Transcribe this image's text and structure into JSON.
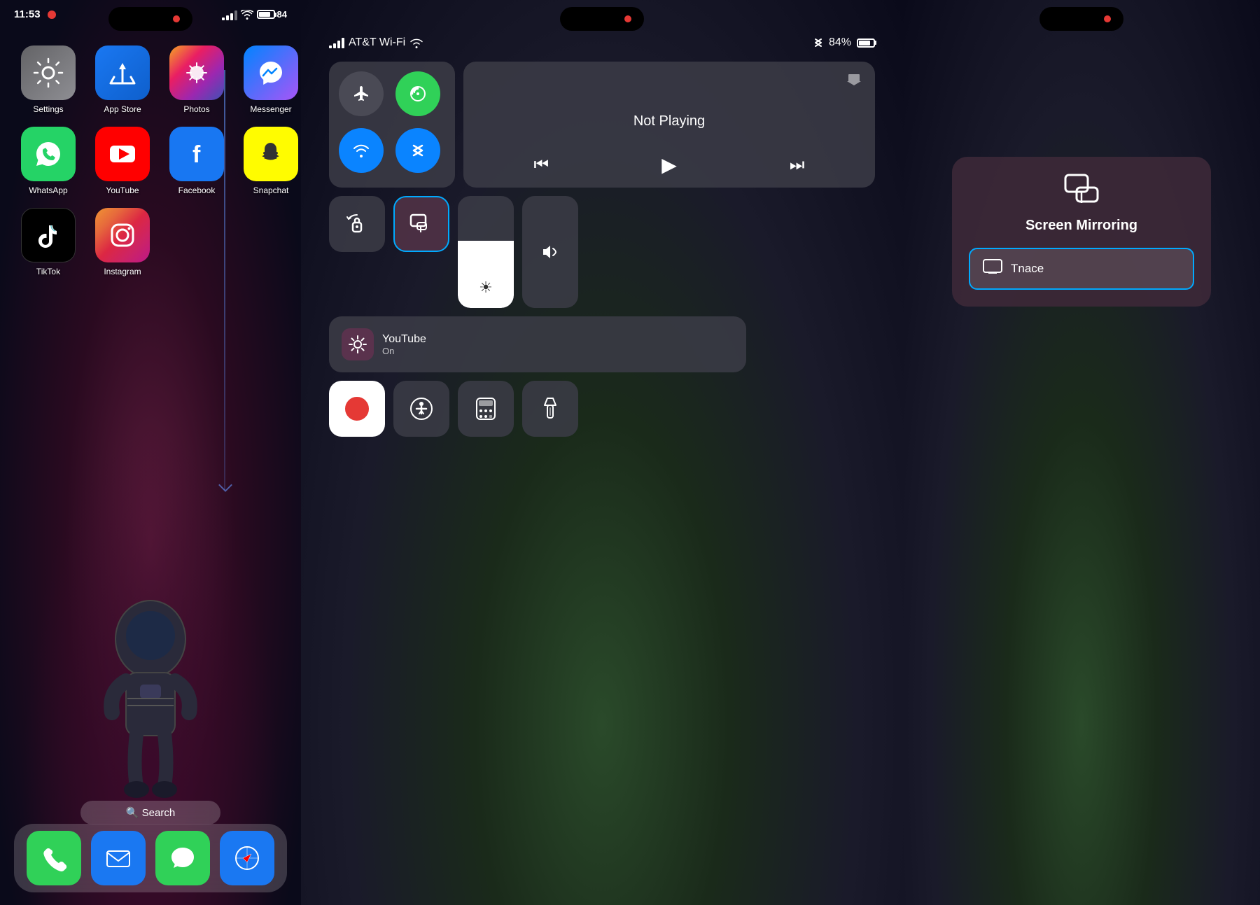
{
  "panel1": {
    "time": "11:53",
    "apps_row1": [
      {
        "name": "Settings",
        "label": "Settings",
        "bg": "bg-settings",
        "icon": "⚙️"
      },
      {
        "name": "App Store",
        "label": "App Store",
        "bg": "bg-appstore",
        "icon": "🅰"
      },
      {
        "name": "Photos",
        "label": "Photos",
        "bg": "bg-photos",
        "icon": "🖼"
      },
      {
        "name": "Messenger",
        "label": "Messenger",
        "bg": "bg-messenger",
        "icon": "💬"
      }
    ],
    "apps_row2": [
      {
        "name": "WhatsApp",
        "label": "WhatsApp",
        "bg": "bg-whatsapp",
        "icon": "📱"
      },
      {
        "name": "YouTube",
        "label": "YouTube",
        "bg": "bg-youtube",
        "icon": "▶"
      },
      {
        "name": "Facebook",
        "label": "Facebook",
        "bg": "bg-facebook",
        "icon": "f"
      },
      {
        "name": "Snapchat",
        "label": "Snapchat",
        "bg": "bg-snapchat",
        "icon": "👻"
      }
    ],
    "apps_row3": [
      {
        "name": "TikTok",
        "label": "TikTok",
        "bg": "bg-tiktok",
        "icon": "♪"
      },
      {
        "name": "Instagram",
        "label": "Instagram",
        "bg": "bg-instagram",
        "icon": "📷"
      }
    ],
    "search_placeholder": "🔍 Search",
    "dock": [
      "📞",
      "✉️",
      "💬",
      "🧭"
    ]
  },
  "panel2": {
    "carrier": "AT&T Wi-Fi",
    "battery_pct": "84%",
    "now_playing": "Not Playing",
    "youtube_label": "YouTube",
    "youtube_sub": "On",
    "buttons": {
      "airplane": "✈️",
      "cellular": "📶",
      "wifi": "wifi",
      "bluetooth": "bluetooth",
      "screen_mirror": "screen_mirror",
      "rotation": "🔒",
      "record": "⏺",
      "accessibility": "accessibility",
      "calculator": "calculator",
      "flashlight": "flashlight"
    }
  },
  "panel3": {
    "screen_mirroring_title": "Screen Mirroring",
    "device_name": "Tnace"
  }
}
